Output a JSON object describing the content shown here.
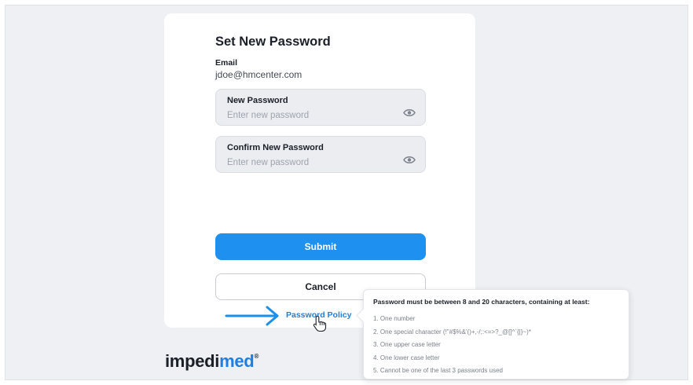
{
  "form": {
    "title": "Set New Password",
    "email_label": "Email",
    "email_value": "jdoe@hmcenter.com",
    "new_password": {
      "label": "New Password",
      "placeholder": "Enter new password",
      "value": "",
      "icon": "eye-icon"
    },
    "confirm_password": {
      "label": "Confirm New Password",
      "placeholder": "Enter new password",
      "value": "",
      "icon": "eye-icon"
    },
    "submit_label": "Submit",
    "cancel_label": "Cancel",
    "policy_link": "Password Policy"
  },
  "brand": {
    "logo_prefix": "impedi",
    "logo_highlight": "med",
    "logo_mark": "®"
  },
  "policy_tooltip": {
    "title": "Password must be between 8 and 20 characters, containing at least:",
    "rules": [
      "1. One number",
      "2. One special character (!\"#$%&'()+,-/;:<=>?_@[]^`{|}~)*",
      "3. One upper case letter",
      "4. One lower case letter",
      "5. Cannot be one of the last 3 passwords used"
    ]
  },
  "colors": {
    "accent": "#1e90f0",
    "link": "#1e7fe0",
    "background": "#eef0f4",
    "text": "#1b1f28"
  }
}
